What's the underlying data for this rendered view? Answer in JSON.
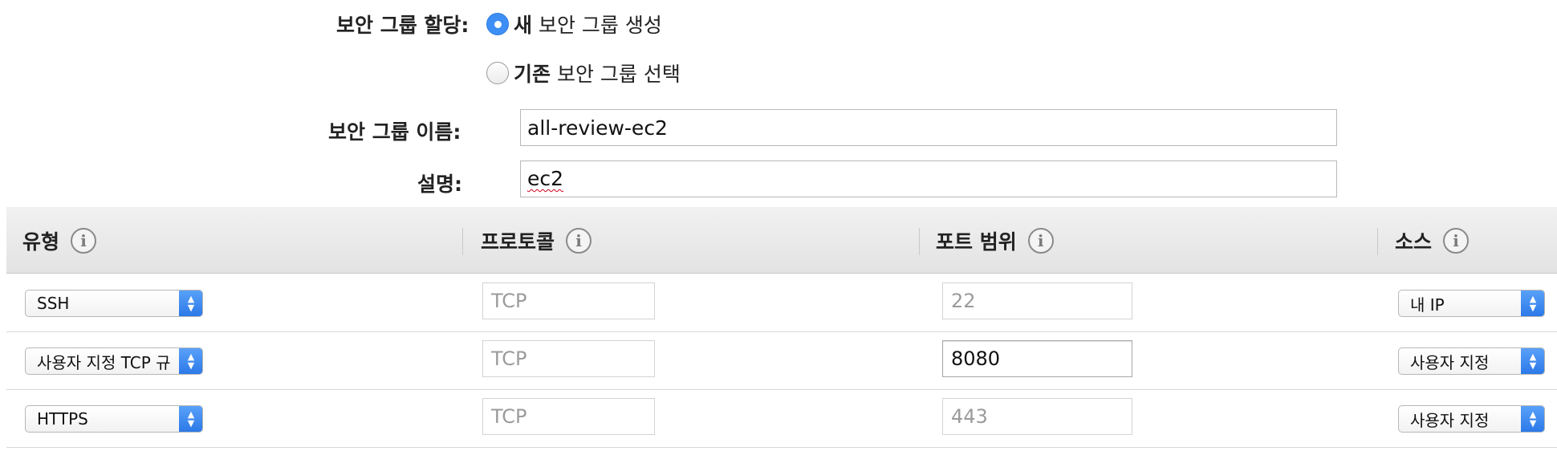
{
  "assignment": {
    "label": "보안 그룹 할당:",
    "options": [
      {
        "bold": "새",
        "rest": " 보안 그룹 생성",
        "selected": true
      },
      {
        "bold": "기존",
        "rest": " 보안 그룹 선택",
        "selected": false
      }
    ]
  },
  "form": {
    "name_label": "보안 그룹 이름:",
    "name_value": "all-review-ec2",
    "desc_label": "설명:",
    "desc_value": "ec2"
  },
  "table": {
    "columns": [
      {
        "label": "유형",
        "icon": "info-icon"
      },
      {
        "label": "프로토콜",
        "icon": "info-icon"
      },
      {
        "label": "포트 범위",
        "icon": "info-icon"
      },
      {
        "label": "소스",
        "icon": "info-icon"
      }
    ],
    "rows": [
      {
        "type": "SSH",
        "protocol": "TCP",
        "port": "22",
        "port_editable": false,
        "source": "내 IP"
      },
      {
        "type": "사용자 지정 TCP 규",
        "protocol": "TCP",
        "port": "8080",
        "port_editable": true,
        "source": "사용자 지정"
      },
      {
        "type": "HTTPS",
        "protocol": "TCP",
        "port": "443",
        "port_editable": false,
        "source": "사용자 지정"
      }
    ]
  },
  "colors": {
    "accent": "#3d8ff5",
    "header_bg": "#e8e8e8"
  }
}
